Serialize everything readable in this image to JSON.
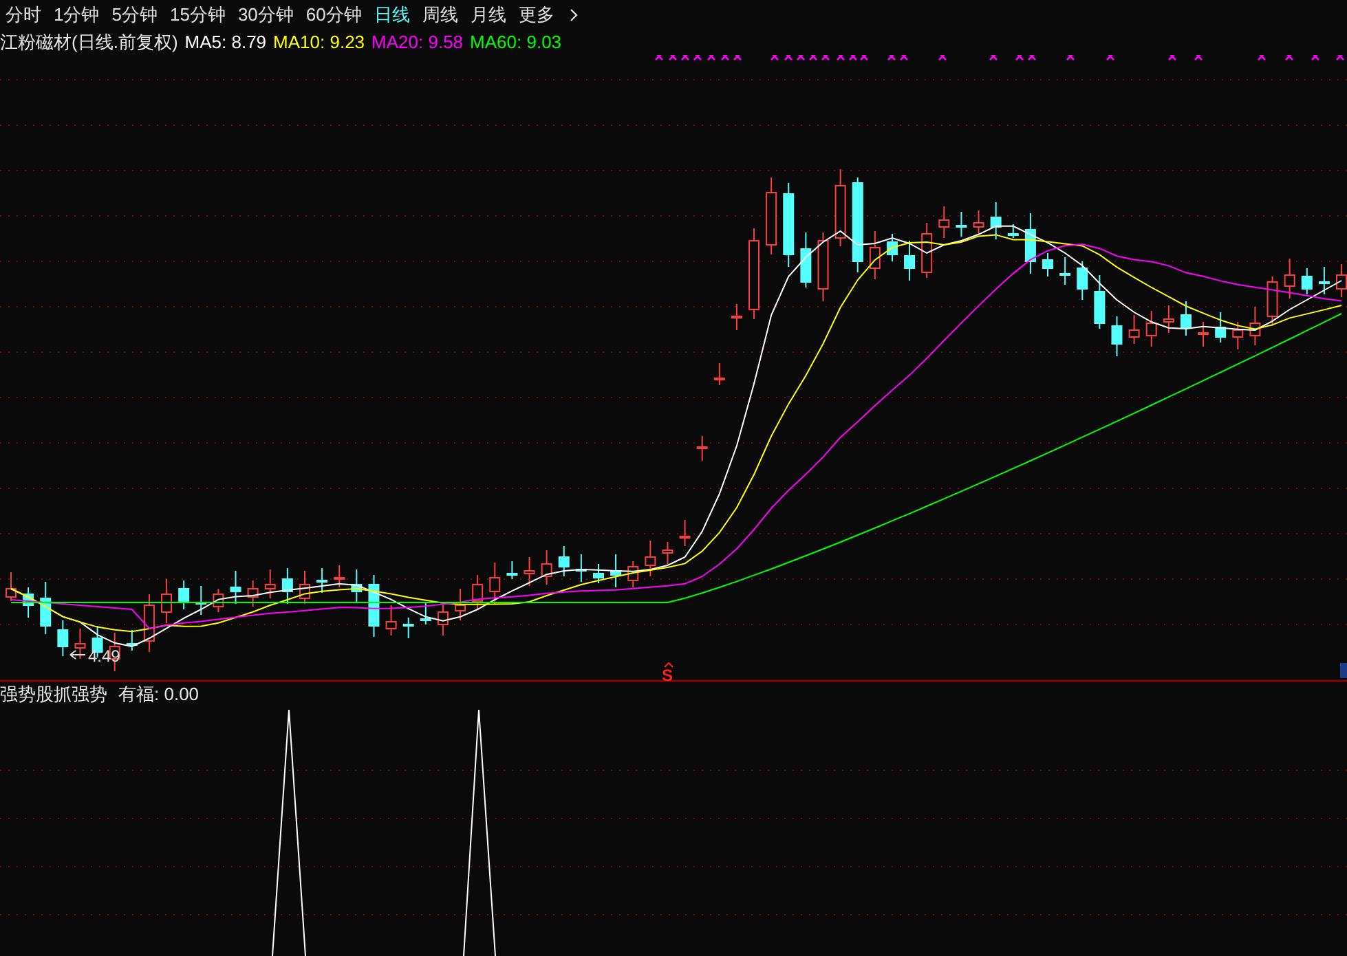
{
  "period_tabs": [
    {
      "label": "分时",
      "selected": false
    },
    {
      "label": "1分钟",
      "selected": false
    },
    {
      "label": "5分钟",
      "selected": false
    },
    {
      "label": "15分钟",
      "selected": false
    },
    {
      "label": "30分钟",
      "selected": false
    },
    {
      "label": "60分钟",
      "selected": false
    },
    {
      "label": "日线",
      "selected": true
    },
    {
      "label": "周线",
      "selected": false
    },
    {
      "label": "月线",
      "selected": false
    },
    {
      "label": "更多",
      "selected": false
    }
  ],
  "legend": {
    "title": "江粉磁材(日线.前复权)",
    "averages": [
      {
        "label": "MA5: 8.79",
        "color": "#ffffff"
      },
      {
        "label": "MA10: 9.23",
        "color": "#ffff00"
      },
      {
        "label": "MA20: 9.58",
        "color": "#ff00ff"
      },
      {
        "label": "MA60: 9.03",
        "color": "#00ff00"
      }
    ]
  },
  "price_chart": {
    "low_label": "4.49",
    "signal_marker": "S"
  },
  "indicator": {
    "title": "强势股抓强势",
    "reading": "有福: 0.00"
  }
}
